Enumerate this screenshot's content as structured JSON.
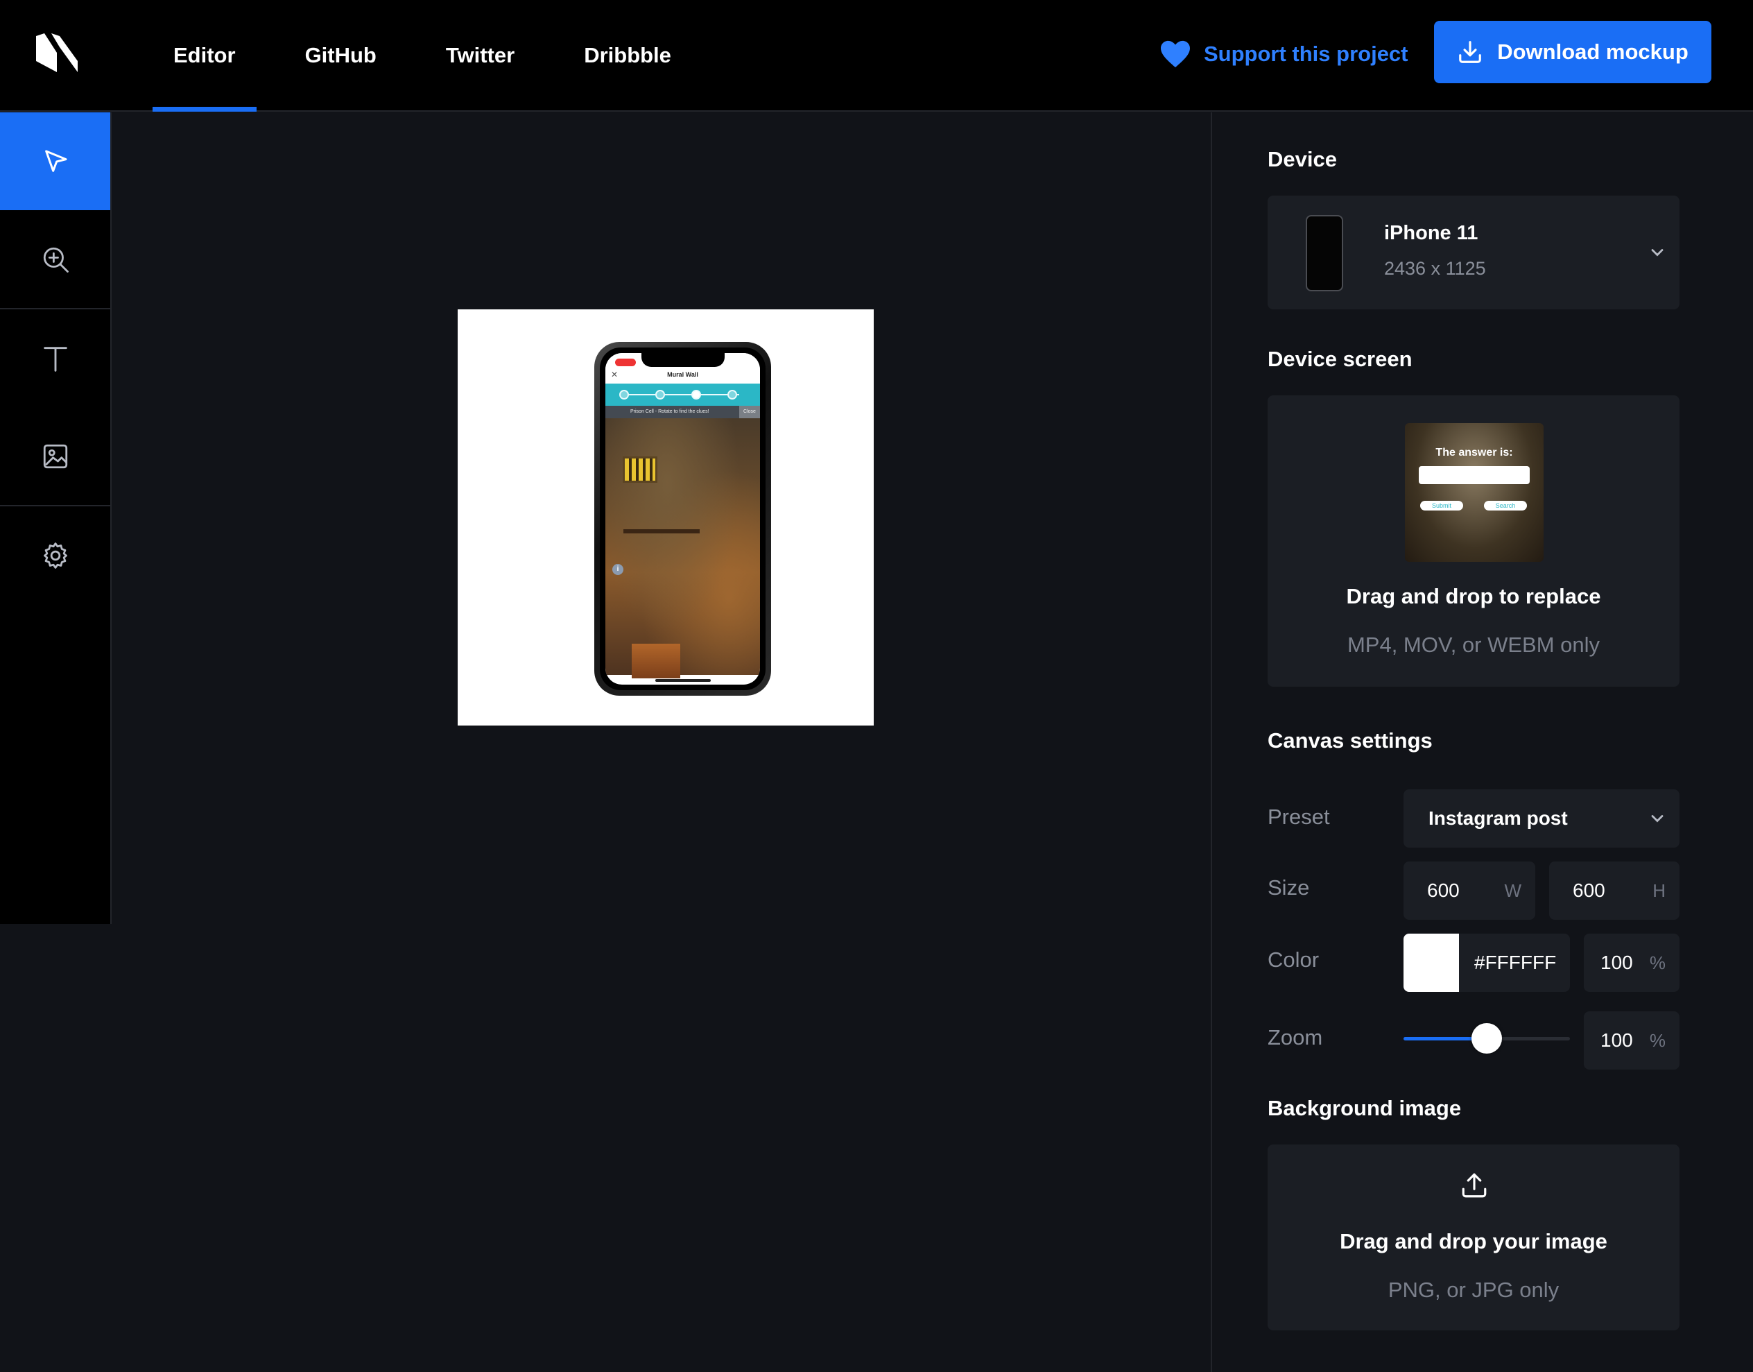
{
  "header": {
    "nav": [
      {
        "label": "Editor",
        "active": true
      },
      {
        "label": "GitHub"
      },
      {
        "label": "Twitter"
      },
      {
        "label": "Dribbble"
      }
    ],
    "support_label": "Support this project",
    "download_label": "Download mockup"
  },
  "toolbar": {
    "tools": [
      "select-tool",
      "zoom-tool",
      "text-tool",
      "image-tool",
      "settings-tool"
    ],
    "active": "select-tool"
  },
  "canvas_preview": {
    "app_title": "Mural Wall",
    "hint_text": "Prison Cell - Rotate to find the clues!",
    "hint_close": "Close"
  },
  "panel": {
    "device": {
      "title": "Device",
      "name": "iPhone 11",
      "resolution": "2436 x 1125"
    },
    "device_screen": {
      "title": "Device screen",
      "thumb_title": "The answer is:",
      "thumb_submit": "Submit",
      "thumb_search": "Search",
      "drop_title": "Drag and drop to replace",
      "drop_sub": "MP4, MOV, or WEBM only"
    },
    "canvas_settings": {
      "title": "Canvas settings",
      "preset_label": "Preset",
      "preset_value": "Instagram post",
      "size_label": "Size",
      "width": "600",
      "width_unit": "W",
      "height": "600",
      "height_unit": "H",
      "color_label": "Color",
      "color_hex": "#FFFFFF",
      "color_opacity": "100",
      "color_opacity_unit": "%",
      "zoom_label": "Zoom",
      "zoom_value": "100",
      "zoom_unit": "%",
      "zoom_level": 0.5
    },
    "background_image": {
      "title": "Background image",
      "drop_title": "Drag and drop your image",
      "drop_sub": "PNG, or JPG only"
    }
  },
  "colors": {
    "accent": "#1a6ef5",
    "background": "#111318",
    "surface": "#1b1e24",
    "muted_text": "#8a8f9a"
  }
}
